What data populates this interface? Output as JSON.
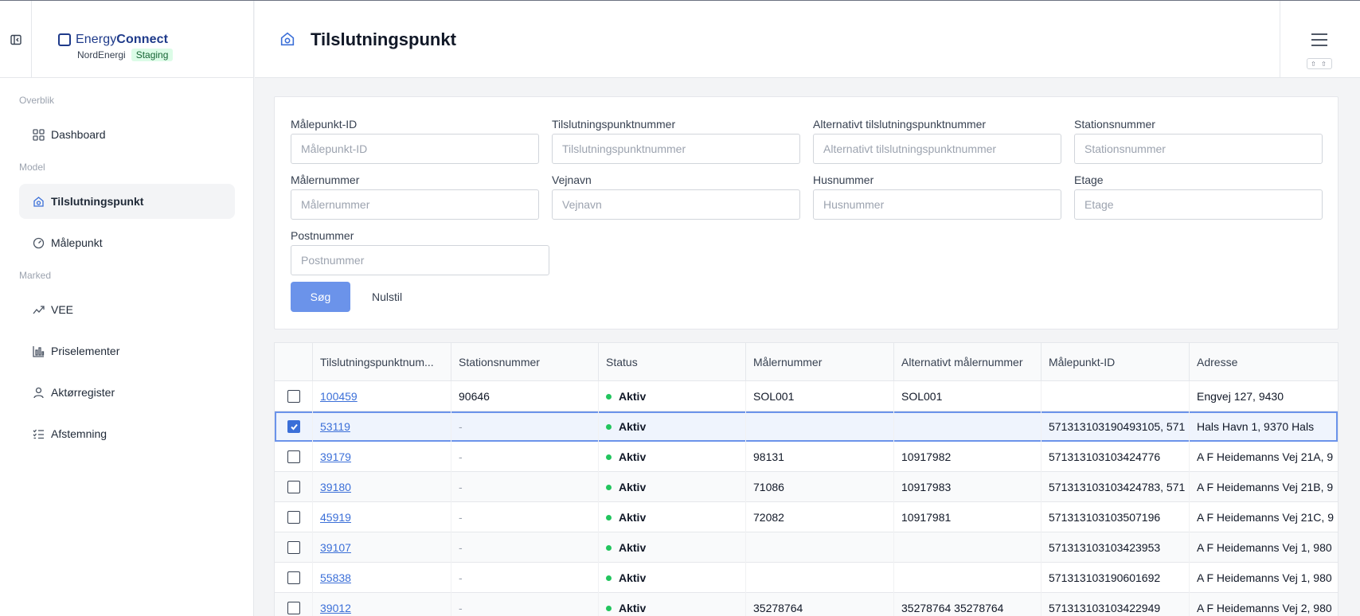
{
  "brand": {
    "name_light": "Energy",
    "name_bold": "Connect",
    "org": "NordEnergi",
    "env": "Staging"
  },
  "sidebar": {
    "sections": [
      {
        "label": "Overblik"
      },
      {
        "label": "Model"
      },
      {
        "label": "Marked"
      }
    ],
    "items": [
      {
        "label": "Dashboard",
        "icon": "grid-icon"
      },
      {
        "label": "Tilslutningspunkt",
        "icon": "house-plug-icon",
        "active": true
      },
      {
        "label": "Målepunkt",
        "icon": "gauge-icon"
      },
      {
        "label": "VEE",
        "icon": "trend-icon"
      },
      {
        "label": "Priselementer",
        "icon": "bar-chart-icon"
      },
      {
        "label": "Aktørregister",
        "icon": "user-icon"
      },
      {
        "label": "Afstemning",
        "icon": "checklist-icon"
      }
    ]
  },
  "header": {
    "title": "Tilslutningspunkt",
    "shortcut": "⇧ ⇧"
  },
  "filters": {
    "fields": [
      {
        "label": "Målepunkt-ID",
        "placeholder": "Målepunkt-ID",
        "value": ""
      },
      {
        "label": "Tilslutningspunktnummer",
        "placeholder": "Tilslutningspunktnummer",
        "value": ""
      },
      {
        "label": "Alternativt tilslutningspunktnummer",
        "placeholder": "Alternativt tilslutningspunktnummer",
        "value": ""
      },
      {
        "label": "Stationsnummer",
        "placeholder": "Stationsnummer",
        "value": ""
      },
      {
        "label": "Målernummer",
        "placeholder": "Målernummer",
        "value": ""
      },
      {
        "label": "Vejnavn",
        "placeholder": "Vejnavn",
        "value": ""
      },
      {
        "label": "Husnummer",
        "placeholder": "Husnummer",
        "value": ""
      },
      {
        "label": "Etage",
        "placeholder": "Etage",
        "value": ""
      },
      {
        "label": "Postnummer",
        "placeholder": "Postnummer",
        "value": ""
      }
    ],
    "search_label": "Søg",
    "reset_label": "Nulstil"
  },
  "table": {
    "columns": [
      "Tilslutningspunktnum...",
      "Stationsnummer",
      "Status",
      "Målernummer",
      "Alternativt målernummer",
      "Målepunkt-ID",
      "Adresse"
    ],
    "rows": [
      {
        "checked": false,
        "id": "100459",
        "station": "90646",
        "status": "Aktiv",
        "meter": "SOL001",
        "alt_meter": "SOL001",
        "mp_id": "",
        "address": "Engvej 127, 9430"
      },
      {
        "checked": true,
        "id": "53119",
        "station": "-",
        "status": "Aktiv",
        "meter": "",
        "alt_meter": "",
        "mp_id": "571313103190493105, 571",
        "address": "Hals Havn 1, 9370 Hals"
      },
      {
        "checked": false,
        "id": "39179",
        "station": "-",
        "status": "Aktiv",
        "meter": "98131",
        "alt_meter": "10917982",
        "mp_id": "571313103103424776",
        "address": "A F Heidemanns Vej 21A, 9"
      },
      {
        "checked": false,
        "id": "39180",
        "station": "-",
        "status": "Aktiv",
        "meter": "71086",
        "alt_meter": "10917983",
        "mp_id": "571313103103424783, 571",
        "address": "A F Heidemanns Vej 21B, 9"
      },
      {
        "checked": false,
        "id": "45919",
        "station": "-",
        "status": "Aktiv",
        "meter": "72082",
        "alt_meter": "10917981",
        "mp_id": "571313103103507196",
        "address": "A F Heidemanns Vej 21C, 9"
      },
      {
        "checked": false,
        "id": "39107",
        "station": "-",
        "status": "Aktiv",
        "meter": "",
        "alt_meter": "",
        "mp_id": "571313103103423953",
        "address": "A F Heidemanns Vej 1, 980"
      },
      {
        "checked": false,
        "id": "55838",
        "station": "-",
        "status": "Aktiv",
        "meter": "",
        "alt_meter": "",
        "mp_id": "571313103190601692",
        "address": "A F Heidemanns Vej 1, 980"
      },
      {
        "checked": false,
        "id": "39012",
        "station": "-",
        "status": "Aktiv",
        "meter": "35278764",
        "alt_meter": "35278764 35278764",
        "mp_id": "571313103103422949",
        "address": "A F Heidemanns Vej 2, 980"
      }
    ]
  },
  "colors": {
    "accent": "#6b93ea",
    "link": "#3b6fd8",
    "status_active": "#22c55e",
    "badge_bg": "#dcfce7"
  }
}
